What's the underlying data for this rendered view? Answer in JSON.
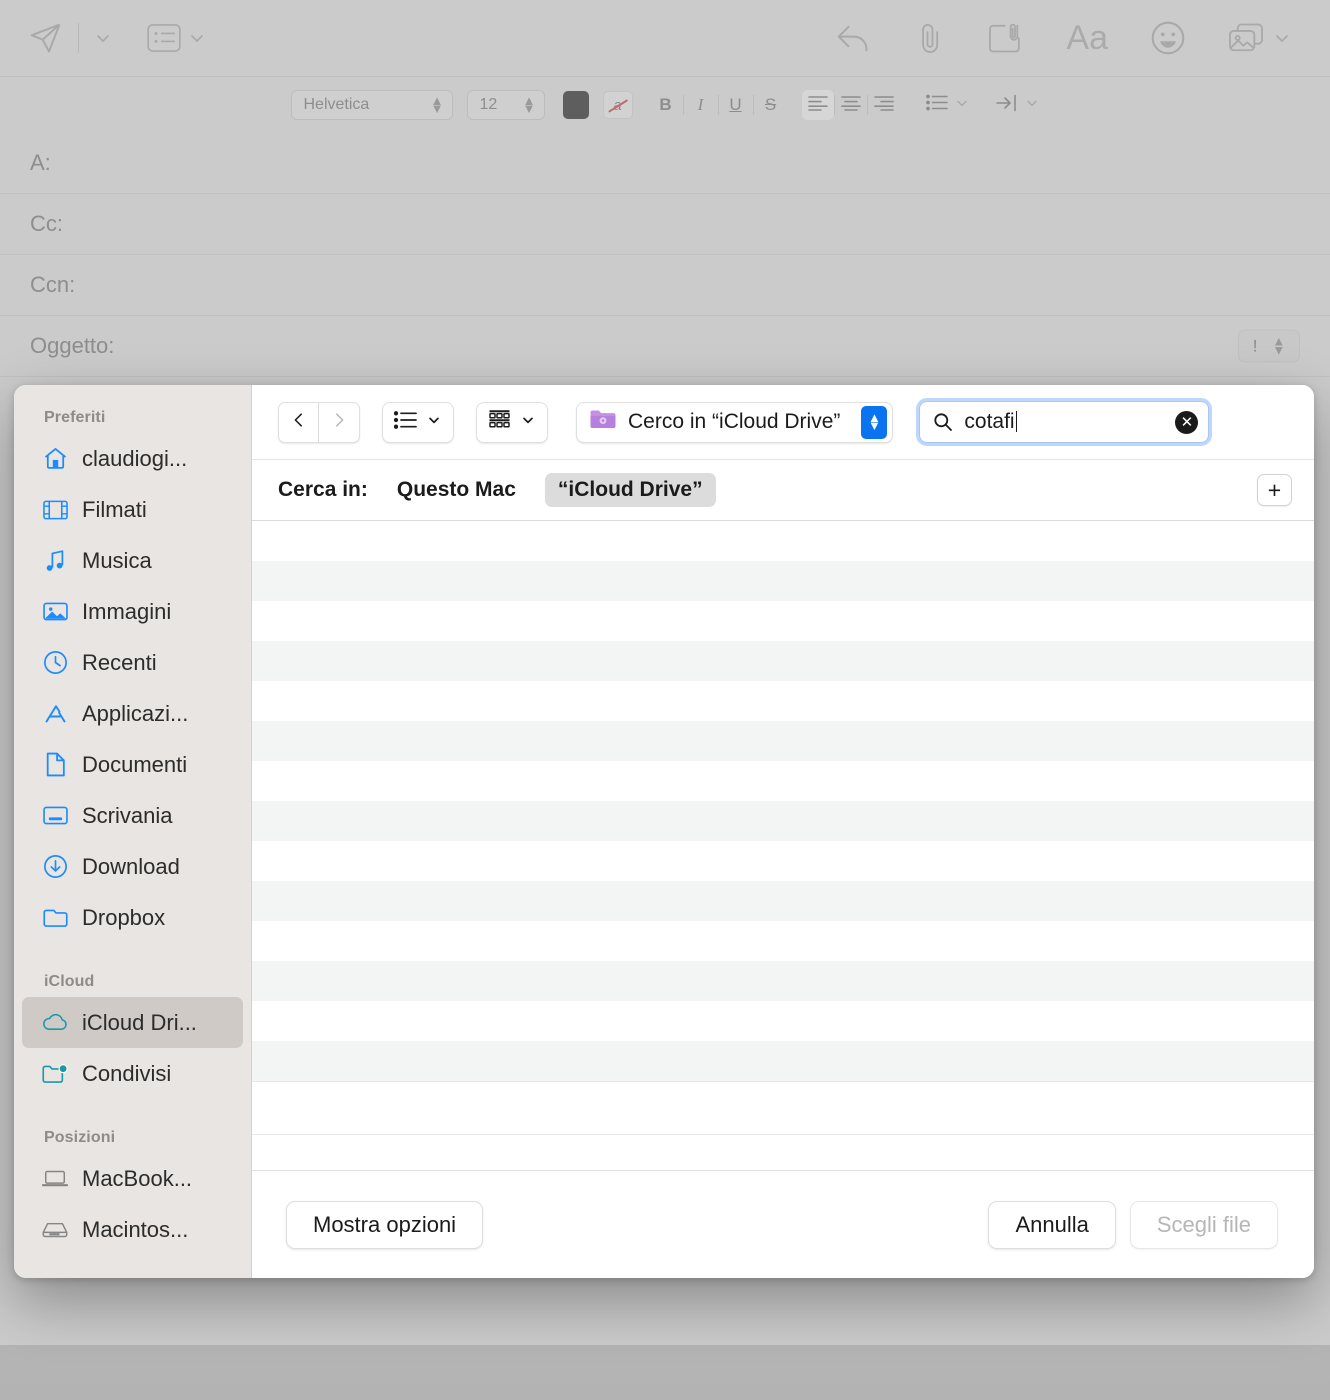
{
  "mail": {
    "toolbar": {
      "send_icon": "send-paper-plane-icon",
      "send_options_icon": "chevron-down-icon",
      "header_fields_icon": "header-fields-icon",
      "header_fields_options_icon": "chevron-down-icon",
      "reply_icon": "reply-arrow-icon",
      "attach_icon": "paperclip-icon",
      "markup_icon": "markup-attach-icon",
      "format_icon_label": "Aa",
      "emoji_icon": "emoji-smiley-icon",
      "photos_icon": "photo-browser-icon",
      "photos_options_icon": "chevron-down-icon"
    },
    "format_bar": {
      "font_family": "Helvetica",
      "font_size": "12",
      "text_color": "#5e5e5e",
      "highlight_label": "a",
      "bold_label": "B",
      "italic_label": "I",
      "underline_label": "U",
      "strikethrough_label": "S",
      "align_left": "align-left-icon",
      "align_center": "align-center-icon",
      "align_right": "align-right-icon",
      "list_icon": "bulleted-list-icon",
      "indent_icon": "indent-icon"
    },
    "header_fields": [
      {
        "label": "A:",
        "value": ""
      },
      {
        "label": "Cc:",
        "value": ""
      },
      {
        "label": "Ccn:",
        "value": ""
      },
      {
        "label": "Oggetto:",
        "value": ""
      }
    ],
    "priority": {
      "icon_label": "!",
      "stepper_up": "▲",
      "stepper_down": "▼"
    }
  },
  "dialog": {
    "sidebar": {
      "sections": [
        {
          "title": "Preferiti",
          "items": [
            {
              "label": "claudiogi...",
              "icon": "home-icon",
              "selected": false
            },
            {
              "label": "Filmati",
              "icon": "movies-icon",
              "selected": false
            },
            {
              "label": "Musica",
              "icon": "music-note-icon",
              "selected": false
            },
            {
              "label": "Immagini",
              "icon": "pictures-icon",
              "selected": false
            },
            {
              "label": "Recenti",
              "icon": "clock-icon",
              "selected": false
            },
            {
              "label": "Applicazi...",
              "icon": "applications-icon",
              "selected": false
            },
            {
              "label": "Documenti",
              "icon": "document-icon",
              "selected": false
            },
            {
              "label": "Scrivania",
              "icon": "desktop-icon",
              "selected": false
            },
            {
              "label": "Download",
              "icon": "download-icon",
              "selected": false
            },
            {
              "label": "Dropbox",
              "icon": "folder-icon",
              "selected": false
            }
          ]
        },
        {
          "title": "iCloud",
          "items": [
            {
              "label": "iCloud Dri...",
              "icon": "icloud-icon",
              "selected": true
            },
            {
              "label": "Condivisi",
              "icon": "shared-folder-icon",
              "selected": false
            }
          ]
        },
        {
          "title": "Posizioni",
          "items": [
            {
              "label": "MacBook...",
              "icon": "laptop-icon",
              "selected": false
            },
            {
              "label": "Macintos...",
              "icon": "harddisk-icon",
              "selected": false
            }
          ]
        }
      ]
    },
    "toolbar": {
      "back_icon": "chevron-left-icon",
      "forward_icon": "chevron-right-icon",
      "list_view_icon": "list-view-icon",
      "list_view_chevron": "chevron-down-icon",
      "group_view_icon": "group-view-icon",
      "group_view_chevron": "chevron-down-icon",
      "location_icon": "smart-folder-icon",
      "location_label": "Cerco in “iCloud Drive”",
      "location_arrows_icon": "up-down-arrows-icon",
      "search_icon": "search-icon",
      "search_value": "cotafi",
      "search_clear_icon": "clear-circle-icon",
      "accent_color": "#0a74f0"
    },
    "scope": {
      "label": "Cerca in:",
      "options": [
        {
          "label": "Questo Mac",
          "active": false
        },
        {
          "label": "“iCloud Drive”",
          "active": true
        }
      ],
      "add_button_label": "+"
    },
    "file_list": {
      "rows": [],
      "row_count": 14,
      "empty": true
    },
    "bottom": {
      "options_label": "Mostra opzioni",
      "cancel_label": "Annulla",
      "choose_label": "Scegli file",
      "choose_disabled": true
    }
  }
}
